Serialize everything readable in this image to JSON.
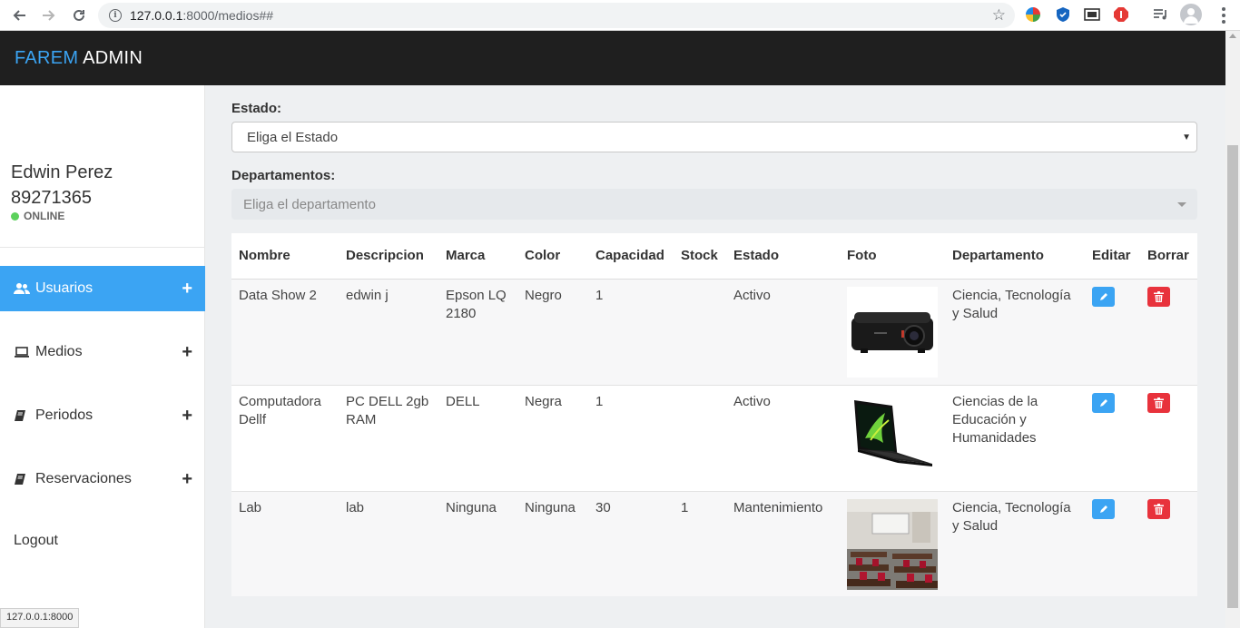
{
  "browser": {
    "url_host": "127.0.0.1",
    "url_rest": ":8000/medios##",
    "status_url": "127.0.0.1:8000"
  },
  "header": {
    "brand_part1": "FAREM",
    "brand_part2": "ADMIN"
  },
  "user": {
    "name": "Edwin Perez",
    "phone": "89271365",
    "status": "ONLINE"
  },
  "sidebar": {
    "items": [
      {
        "label": "Usuarios",
        "icon": "users-icon",
        "active": true
      },
      {
        "label": "Medios",
        "icon": "laptop-icon",
        "active": false
      },
      {
        "label": "Periodos",
        "icon": "book-icon",
        "active": false
      },
      {
        "label": "Reservaciones",
        "icon": "book-icon",
        "active": false
      }
    ],
    "logout": "Logout"
  },
  "filters": {
    "estado_label": "Estado:",
    "estado_value": "Eliga el Estado",
    "departamentos_label": "Departamentos:",
    "departamentos_placeholder": "Eliga el departamento"
  },
  "table": {
    "headers": [
      "Nombre",
      "Descripcion",
      "Marca",
      "Color",
      "Capacidad",
      "Stock",
      "Estado",
      "Foto",
      "Departamento",
      "Editar",
      "Borrar"
    ],
    "rows": [
      {
        "nombre": "Data Show 2",
        "descripcion": "edwin j",
        "marca": "Epson LQ 2180",
        "color": "Negro",
        "capacidad": "1",
        "stock": "",
        "estado": "Activo",
        "foto": "projector-photo",
        "departamento": "Ciencia, Tecnología y Salud"
      },
      {
        "nombre": "Computadora Dellf",
        "descripcion": "PC DELL 2gb RAM",
        "marca": "DELL",
        "color": "Negra",
        "capacidad": "1",
        "stock": "",
        "estado": "Activo",
        "foto": "laptop-photo",
        "departamento": "Ciencias de la Educación y Humanidades"
      },
      {
        "nombre": "Lab",
        "descripcion": "lab",
        "marca": "Ninguna",
        "color": "Ninguna",
        "capacidad": "30",
        "stock": "1",
        "estado": "Mantenimiento",
        "foto": "classroom-photo",
        "departamento": "Ciencia, Tecnología y Salud"
      }
    ]
  },
  "colors": {
    "accent": "#3ba4f3",
    "header_bg": "#1f1f1f",
    "danger": "#e8323c",
    "online": "#5cd15c"
  }
}
